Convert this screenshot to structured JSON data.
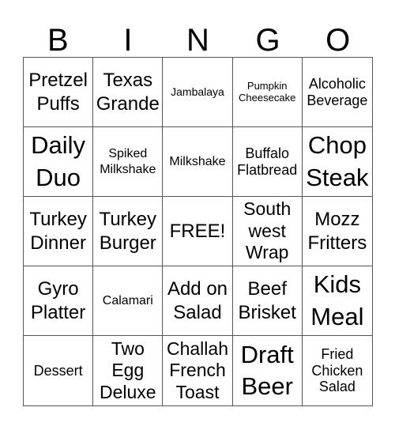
{
  "header": [
    "B",
    "I",
    "N",
    "G",
    "O"
  ],
  "cells": [
    "Pretzel Puffs",
    "Texas Grande",
    "Jambalaya",
    "Pumpkin Cheesecake",
    "Alcoholic Beverage",
    "Daily Duo",
    "Spiked Milkshake",
    "Milkshake",
    "Buffalo Flatbread",
    "Chop Steak",
    "Turkey Dinner",
    "Turkey Burger",
    "FREE!",
    "South west Wrap",
    "Mozz Fritters",
    "Gyro Platter",
    "Calamari",
    "Add on Salad",
    "Beef Brisket",
    "Kids Meal",
    "Dessert",
    "Two Egg Deluxe",
    "Challah French Toast",
    "Draft Beer",
    "Fried Chicken Salad"
  ]
}
